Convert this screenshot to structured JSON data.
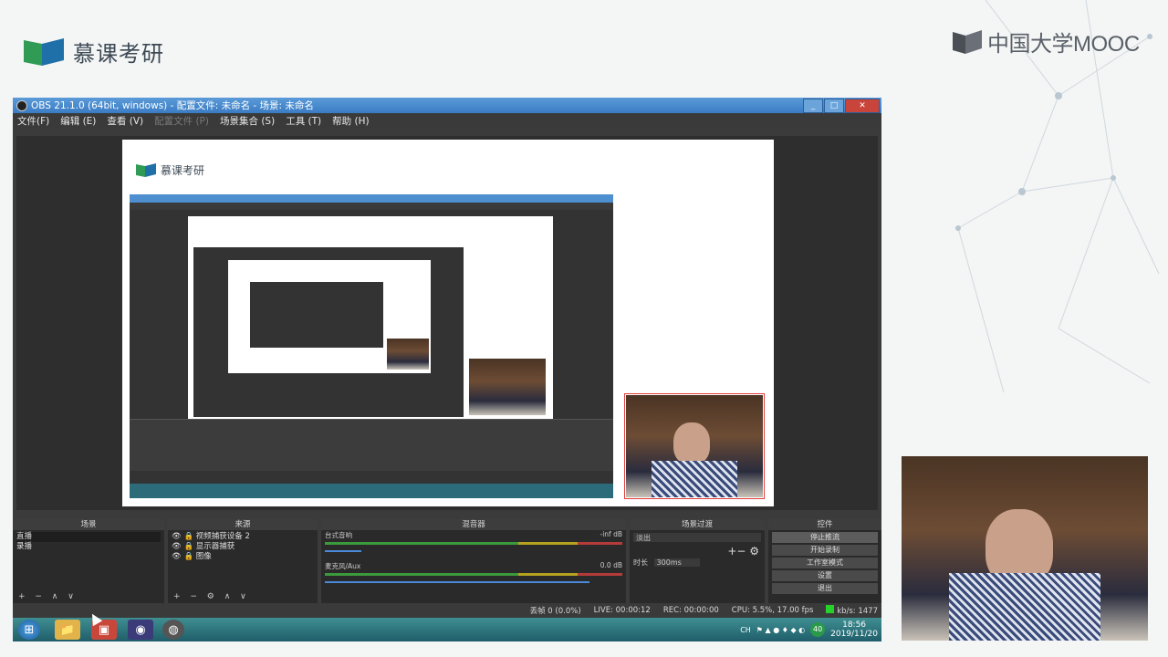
{
  "brand": {
    "left_text": "慕课考研",
    "right_text": "中国大学MOOC"
  },
  "window": {
    "title": "OBS 21.1.0 (64bit, windows) - 配置文件: 未命名 - 场景: 未命名",
    "min": "_",
    "max": "□",
    "close": "✕"
  },
  "menu": [
    {
      "label": "文件(F)",
      "disabled": false
    },
    {
      "label": "编辑 (E)",
      "disabled": false
    },
    {
      "label": "查看 (V)",
      "disabled": false
    },
    {
      "label": "配置文件 (P)",
      "disabled": true
    },
    {
      "label": "场景集合 (S)",
      "disabled": false
    },
    {
      "label": "工具 (T)",
      "disabled": false
    },
    {
      "label": "帮助 (H)",
      "disabled": false
    }
  ],
  "preview": {
    "canvas_brand": "慕课考研"
  },
  "docks": {
    "scenes": {
      "header": "场景",
      "items": [
        "直播",
        "录播"
      ],
      "tools": "+ − ∧ ∨"
    },
    "sources": {
      "header": "来源",
      "items": [
        "视频捕获设备 2",
        "显示器捕获",
        "图像"
      ],
      "tools": "+ − ⚙ ∧ ∨"
    },
    "mixer": {
      "header": "混音器",
      "channels": [
        {
          "name": "台式音响",
          "level": "-inf dB"
        },
        {
          "name": "麦克风/Aux",
          "level": "0.0 dB"
        }
      ]
    },
    "transitions": {
      "header": "场景过渡",
      "type": "淡出",
      "duration_label": "时长",
      "duration": "300ms"
    },
    "controls": {
      "header": "控件",
      "buttons": [
        "停止推流",
        "开始录制",
        "工作室模式",
        "设置",
        "退出"
      ]
    }
  },
  "status": {
    "dropped": "丢帧 0 (0.0%)",
    "live": "LIVE: 00:00:12",
    "rec": "REC: 00:00:00",
    "cpu": "CPU: 5.5%, 17.00 fps",
    "kbs": "kb/s: 1477"
  },
  "taskbar": {
    "lang": "CH",
    "time": "18:56",
    "date": "2019/11/20",
    "badge": "40"
  },
  "colors": {
    "accent": "#3a7cc4",
    "live_green": "#25d12a",
    "taskbar": "#2b6b7a"
  }
}
